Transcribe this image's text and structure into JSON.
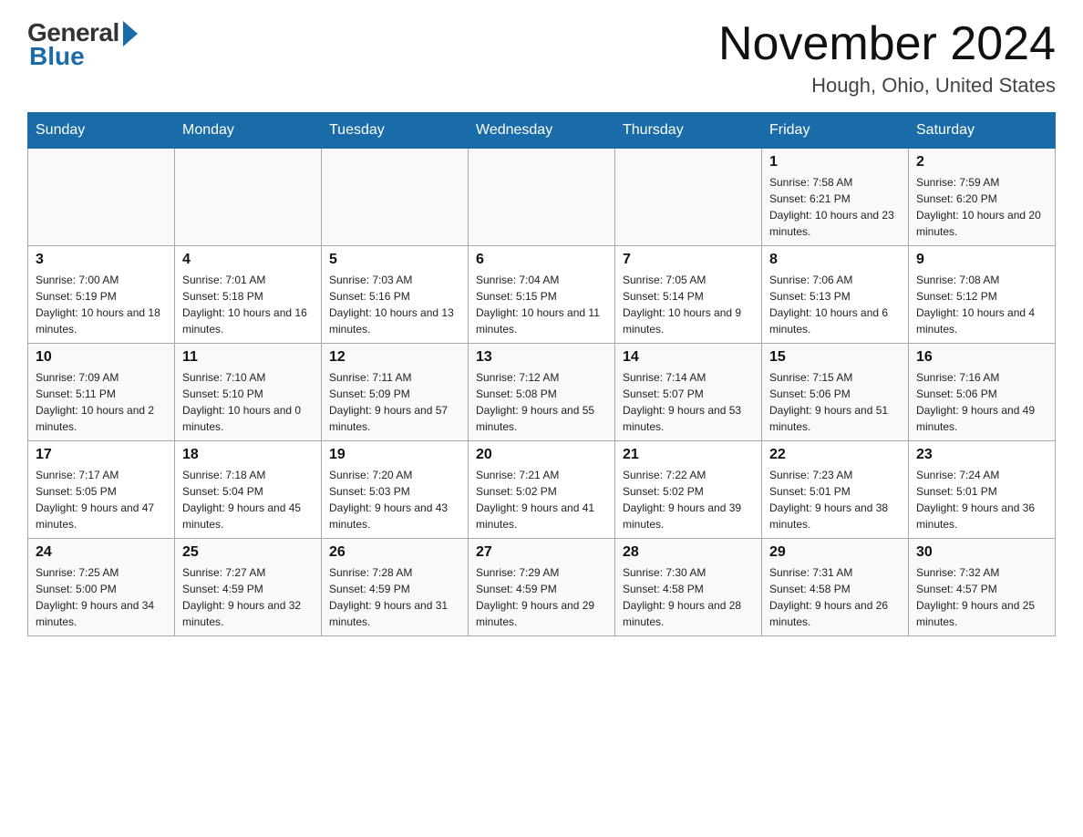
{
  "header": {
    "logo_general": "General",
    "logo_blue": "Blue",
    "month_title": "November 2024",
    "location": "Hough, Ohio, United States"
  },
  "calendar": {
    "days_of_week": [
      "Sunday",
      "Monday",
      "Tuesday",
      "Wednesday",
      "Thursday",
      "Friday",
      "Saturday"
    ],
    "weeks": [
      {
        "days": [
          {
            "date": "",
            "info": ""
          },
          {
            "date": "",
            "info": ""
          },
          {
            "date": "",
            "info": ""
          },
          {
            "date": "",
            "info": ""
          },
          {
            "date": "",
            "info": ""
          },
          {
            "date": "1",
            "info": "Sunrise: 7:58 AM\nSunset: 6:21 PM\nDaylight: 10 hours and 23 minutes."
          },
          {
            "date": "2",
            "info": "Sunrise: 7:59 AM\nSunset: 6:20 PM\nDaylight: 10 hours and 20 minutes."
          }
        ]
      },
      {
        "days": [
          {
            "date": "3",
            "info": "Sunrise: 7:00 AM\nSunset: 5:19 PM\nDaylight: 10 hours and 18 minutes."
          },
          {
            "date": "4",
            "info": "Sunrise: 7:01 AM\nSunset: 5:18 PM\nDaylight: 10 hours and 16 minutes."
          },
          {
            "date": "5",
            "info": "Sunrise: 7:03 AM\nSunset: 5:16 PM\nDaylight: 10 hours and 13 minutes."
          },
          {
            "date": "6",
            "info": "Sunrise: 7:04 AM\nSunset: 5:15 PM\nDaylight: 10 hours and 11 minutes."
          },
          {
            "date": "7",
            "info": "Sunrise: 7:05 AM\nSunset: 5:14 PM\nDaylight: 10 hours and 9 minutes."
          },
          {
            "date": "8",
            "info": "Sunrise: 7:06 AM\nSunset: 5:13 PM\nDaylight: 10 hours and 6 minutes."
          },
          {
            "date": "9",
            "info": "Sunrise: 7:08 AM\nSunset: 5:12 PM\nDaylight: 10 hours and 4 minutes."
          }
        ]
      },
      {
        "days": [
          {
            "date": "10",
            "info": "Sunrise: 7:09 AM\nSunset: 5:11 PM\nDaylight: 10 hours and 2 minutes."
          },
          {
            "date": "11",
            "info": "Sunrise: 7:10 AM\nSunset: 5:10 PM\nDaylight: 10 hours and 0 minutes."
          },
          {
            "date": "12",
            "info": "Sunrise: 7:11 AM\nSunset: 5:09 PM\nDaylight: 9 hours and 57 minutes."
          },
          {
            "date": "13",
            "info": "Sunrise: 7:12 AM\nSunset: 5:08 PM\nDaylight: 9 hours and 55 minutes."
          },
          {
            "date": "14",
            "info": "Sunrise: 7:14 AM\nSunset: 5:07 PM\nDaylight: 9 hours and 53 minutes."
          },
          {
            "date": "15",
            "info": "Sunrise: 7:15 AM\nSunset: 5:06 PM\nDaylight: 9 hours and 51 minutes."
          },
          {
            "date": "16",
            "info": "Sunrise: 7:16 AM\nSunset: 5:06 PM\nDaylight: 9 hours and 49 minutes."
          }
        ]
      },
      {
        "days": [
          {
            "date": "17",
            "info": "Sunrise: 7:17 AM\nSunset: 5:05 PM\nDaylight: 9 hours and 47 minutes."
          },
          {
            "date": "18",
            "info": "Sunrise: 7:18 AM\nSunset: 5:04 PM\nDaylight: 9 hours and 45 minutes."
          },
          {
            "date": "19",
            "info": "Sunrise: 7:20 AM\nSunset: 5:03 PM\nDaylight: 9 hours and 43 minutes."
          },
          {
            "date": "20",
            "info": "Sunrise: 7:21 AM\nSunset: 5:02 PM\nDaylight: 9 hours and 41 minutes."
          },
          {
            "date": "21",
            "info": "Sunrise: 7:22 AM\nSunset: 5:02 PM\nDaylight: 9 hours and 39 minutes."
          },
          {
            "date": "22",
            "info": "Sunrise: 7:23 AM\nSunset: 5:01 PM\nDaylight: 9 hours and 38 minutes."
          },
          {
            "date": "23",
            "info": "Sunrise: 7:24 AM\nSunset: 5:01 PM\nDaylight: 9 hours and 36 minutes."
          }
        ]
      },
      {
        "days": [
          {
            "date": "24",
            "info": "Sunrise: 7:25 AM\nSunset: 5:00 PM\nDaylight: 9 hours and 34 minutes."
          },
          {
            "date": "25",
            "info": "Sunrise: 7:27 AM\nSunset: 4:59 PM\nDaylight: 9 hours and 32 minutes."
          },
          {
            "date": "26",
            "info": "Sunrise: 7:28 AM\nSunset: 4:59 PM\nDaylight: 9 hours and 31 minutes."
          },
          {
            "date": "27",
            "info": "Sunrise: 7:29 AM\nSunset: 4:59 PM\nDaylight: 9 hours and 29 minutes."
          },
          {
            "date": "28",
            "info": "Sunrise: 7:30 AM\nSunset: 4:58 PM\nDaylight: 9 hours and 28 minutes."
          },
          {
            "date": "29",
            "info": "Sunrise: 7:31 AM\nSunset: 4:58 PM\nDaylight: 9 hours and 26 minutes."
          },
          {
            "date": "30",
            "info": "Sunrise: 7:32 AM\nSunset: 4:57 PM\nDaylight: 9 hours and 25 minutes."
          }
        ]
      }
    ]
  }
}
